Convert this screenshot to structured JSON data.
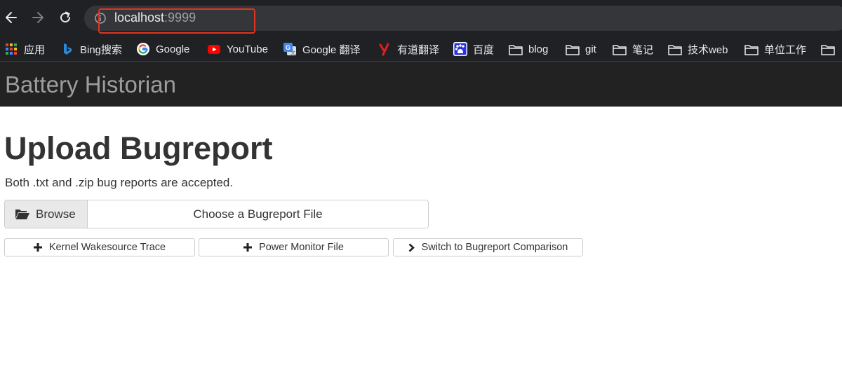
{
  "browser": {
    "url_host": "localhost",
    "url_port": ":9999",
    "bookmarks": [
      {
        "label": "应用",
        "icon": "apps-grid-icon"
      },
      {
        "label": "Bing搜索",
        "icon": "bing-icon"
      },
      {
        "label": "Google",
        "icon": "google-icon"
      },
      {
        "label": "YouTube",
        "icon": "youtube-icon"
      },
      {
        "label": "Google 翻译",
        "icon": "google-translate-icon"
      },
      {
        "label": "有道翻译",
        "icon": "youdao-icon"
      },
      {
        "label": "百度",
        "icon": "baidu-icon"
      },
      {
        "label": "blog",
        "icon": "folder-icon"
      },
      {
        "label": "git",
        "icon": "folder-icon"
      },
      {
        "label": "笔记",
        "icon": "folder-icon"
      },
      {
        "label": "技术web",
        "icon": "folder-icon"
      },
      {
        "label": "单位工作",
        "icon": "folder-icon"
      }
    ]
  },
  "header": {
    "title": "Battery Historian"
  },
  "main": {
    "heading": "Upload Bugreport",
    "subtext": "Both .txt and .zip bug reports are accepted.",
    "browse_label": "Browse",
    "file_placeholder": "Choose a Bugreport File",
    "buttons": [
      {
        "label": "Kernel Wakesource Trace",
        "icon": "plus-icon"
      },
      {
        "label": "Power Monitor File",
        "icon": "plus-icon"
      },
      {
        "label": "Switch to Bugreport Comparison",
        "icon": "chevron-right-icon"
      }
    ]
  },
  "colors": {
    "chrome_bg": "#202124",
    "header_bg": "#222222",
    "title_text": "#9d9d9d",
    "highlight": "#e0341e"
  }
}
